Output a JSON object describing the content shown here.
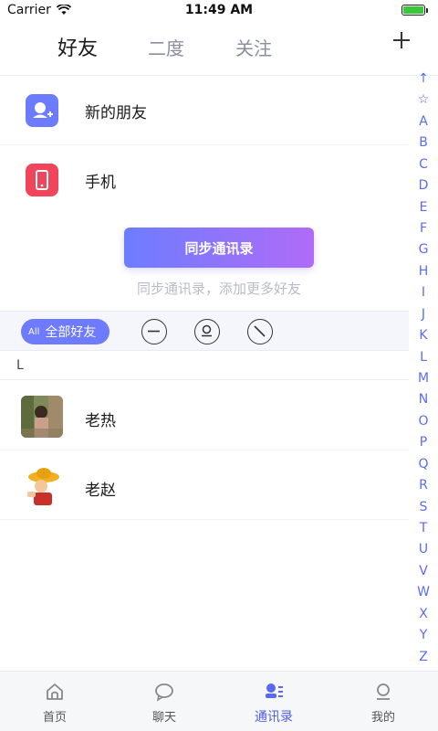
{
  "status_bar": {
    "carrier": "Carrier",
    "time": "11:49 AM",
    "battery_color": "#3ac73a"
  },
  "top_tabs": {
    "tabs": [
      "好友",
      "二度",
      "关注"
    ],
    "active_index": 0
  },
  "header": {
    "add_icon": "plus-icon"
  },
  "quick_rows": [
    {
      "label": "新的朋友",
      "icon": "new-friend-icon",
      "color": "#6b7cff"
    },
    {
      "label": "手机",
      "icon": "phone-icon",
      "color": "#f0455b"
    }
  ],
  "sync": {
    "button_label": "同步通讯录",
    "hint": "同步通讯录，添加更多好友",
    "gradient": [
      "#6d7dff",
      "#b06bf7"
    ]
  },
  "filter_bar": {
    "pill_tag": "All",
    "pill_label": "全部好友",
    "icons": [
      "minus-circle-icon",
      "person-circle-icon",
      "slash-circle-icon"
    ],
    "accent": "#6e7bff"
  },
  "contacts": {
    "section_letter": "L",
    "items": [
      {
        "name": "老热",
        "avatar": "photo-avatar"
      },
      {
        "name": "老赵",
        "avatar": "cartoon-avatar"
      }
    ]
  },
  "index_letters": [
    "↑",
    "☆",
    "A",
    "B",
    "C",
    "D",
    "E",
    "F",
    "G",
    "H",
    "I",
    "J",
    "K",
    "L",
    "M",
    "N",
    "O",
    "P",
    "Q",
    "R",
    "S",
    "T",
    "U",
    "V",
    "W",
    "X",
    "Y",
    "Z"
  ],
  "bottom_nav": {
    "items": [
      {
        "label": "首页",
        "icon": "home-icon"
      },
      {
        "label": "聊天",
        "icon": "chat-icon"
      },
      {
        "label": "通讯录",
        "icon": "contacts-icon"
      },
      {
        "label": "我的",
        "icon": "profile-icon"
      }
    ],
    "active_index": 2,
    "active_color": "#4f5fe0"
  }
}
